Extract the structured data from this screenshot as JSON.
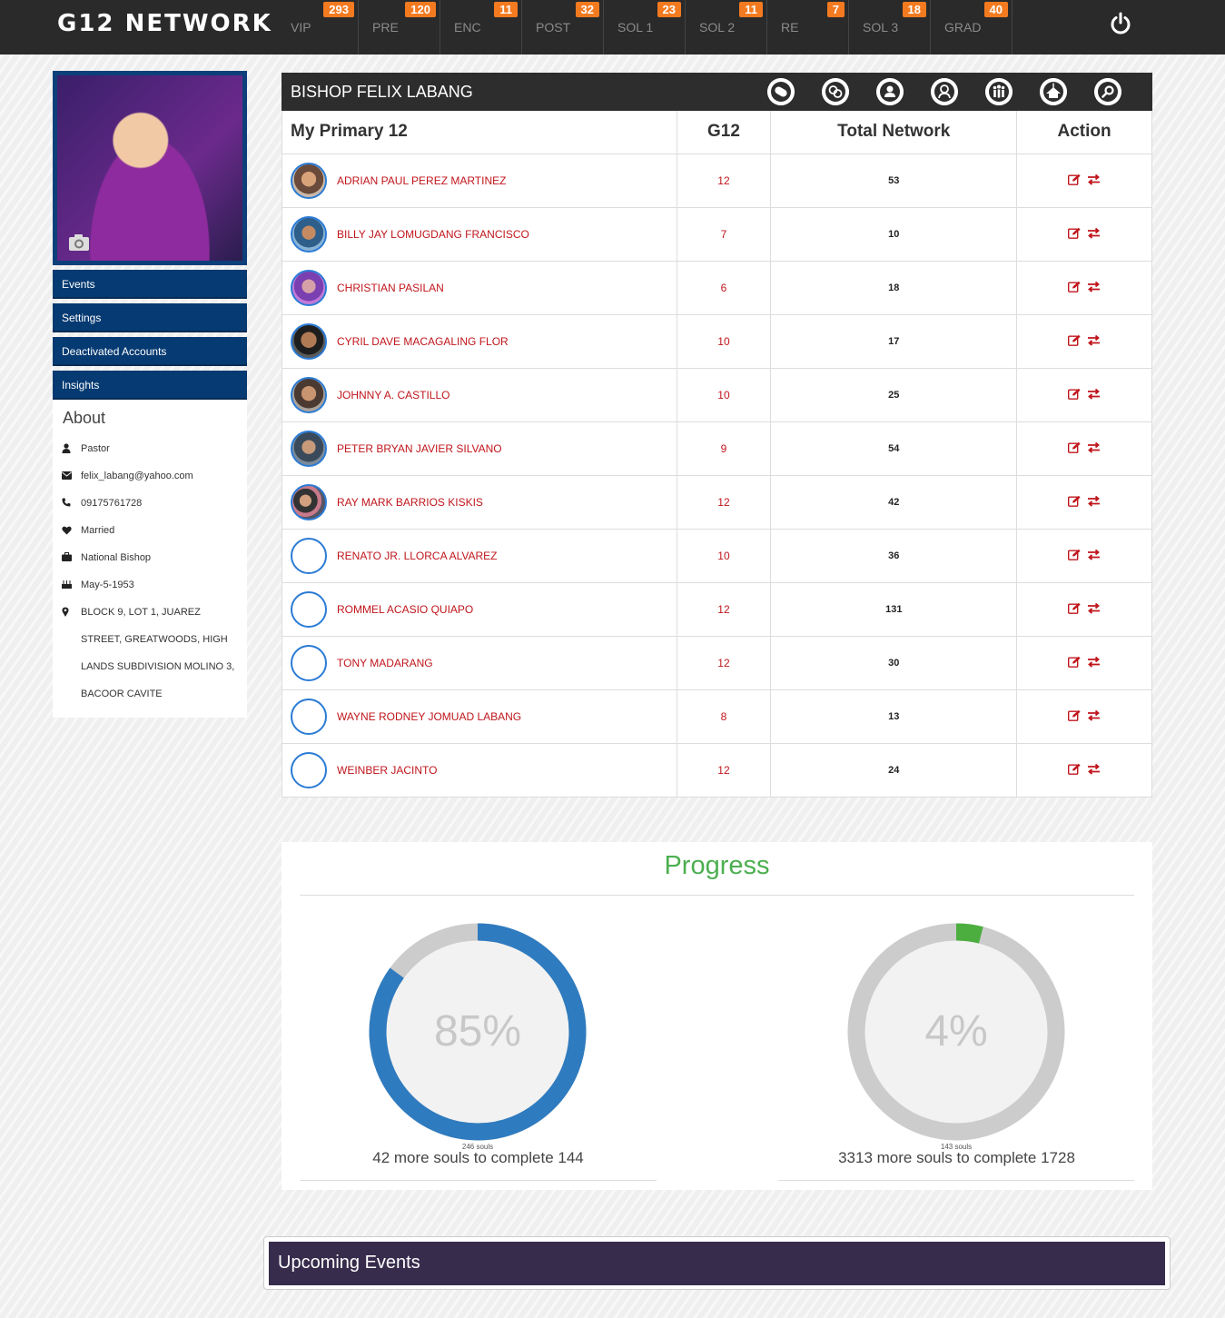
{
  "brand": "G12 NETWORK",
  "nav": [
    {
      "label": "VIP",
      "count": "293"
    },
    {
      "label": "PRE",
      "count": "120"
    },
    {
      "label": "ENC",
      "count": "11"
    },
    {
      "label": "POST",
      "count": "32"
    },
    {
      "label": "SOL 1",
      "count": "23"
    },
    {
      "label": "SOL 2",
      "count": "11"
    },
    {
      "label": "RE",
      "count": "7"
    },
    {
      "label": "SOL 3",
      "count": "18"
    },
    {
      "label": "GRAD",
      "count": "40"
    }
  ],
  "sidebar": {
    "buttons": [
      "Events",
      "Settings",
      "Deactivated Accounts",
      "Insights"
    ],
    "about_title": "About",
    "about": {
      "role": "Pastor",
      "email": "felix_labang@yahoo.com",
      "phone": "09175761728",
      "status": "Married",
      "position": "National Bishop",
      "birthday": "May-5-1953",
      "address": "BLOCK 9, LOT 1, JUAREZ STREET, GREATWOODS, HIGH LANDS SUBDIVISION MOLINO 3, BACOOR CAVITE"
    }
  },
  "panel": {
    "title": "BISHOP FELIX LABANG",
    "headers": [
      "My Primary 12",
      "G12",
      "Total Network",
      "Action"
    ],
    "rows": [
      {
        "name": "ADRIAN PAUL PEREZ MARTINEZ",
        "g12": "12",
        "total": "53",
        "photo": true
      },
      {
        "name": "BILLY JAY LOMUGDANG FRANCISCO",
        "g12": "7",
        "total": "10",
        "photo": true
      },
      {
        "name": "CHRISTIAN PASILAN",
        "g12": "6",
        "total": "18",
        "photo": true
      },
      {
        "name": "CYRIL DAVE MACAGALING FLOR",
        "g12": "10",
        "total": "17",
        "photo": true
      },
      {
        "name": "JOHNNY A. CASTILLO",
        "g12": "10",
        "total": "25",
        "photo": true
      },
      {
        "name": "PETER BRYAN JAVIER SILVANO",
        "g12": "9",
        "total": "54",
        "photo": true
      },
      {
        "name": "RAY MARK BARRIOS KISKIS",
        "g12": "12",
        "total": "42",
        "photo": true
      },
      {
        "name": "RENATO JR. LLORCA ALVAREZ",
        "g12": "10",
        "total": "36",
        "photo": false
      },
      {
        "name": "ROMMEL ACASIO QUIAPO",
        "g12": "12",
        "total": "131",
        "photo": false
      },
      {
        "name": "TONY MADARANG",
        "g12": "12",
        "total": "30",
        "photo": false
      },
      {
        "name": "WAYNE RODNEY JOMUAD LABANG",
        "g12": "8",
        "total": "13",
        "photo": false
      },
      {
        "name": "WEINBER JACINTO",
        "g12": "12",
        "total": "24",
        "photo": false
      }
    ]
  },
  "progress": {
    "title": "Progress",
    "gauges": [
      {
        "percent_label": "85%",
        "fraction": 0.85,
        "color": "#2f7bbf",
        "souls": "246 souls",
        "caption": "42 more souls to complete 144"
      },
      {
        "percent_label": "4%",
        "fraction": 0.04,
        "color": "#4cae3f",
        "souls": "143 souls",
        "caption": "3313 more souls to complete 1728"
      }
    ]
  },
  "events": {
    "title": "Upcoming Events"
  },
  "colors": {
    "accent": "#f47a20",
    "nav_bg": "#2a2a2a",
    "sidebar_btn": "#063a72",
    "name_red": "#c0161c",
    "events_bar": "#372c4c"
  }
}
